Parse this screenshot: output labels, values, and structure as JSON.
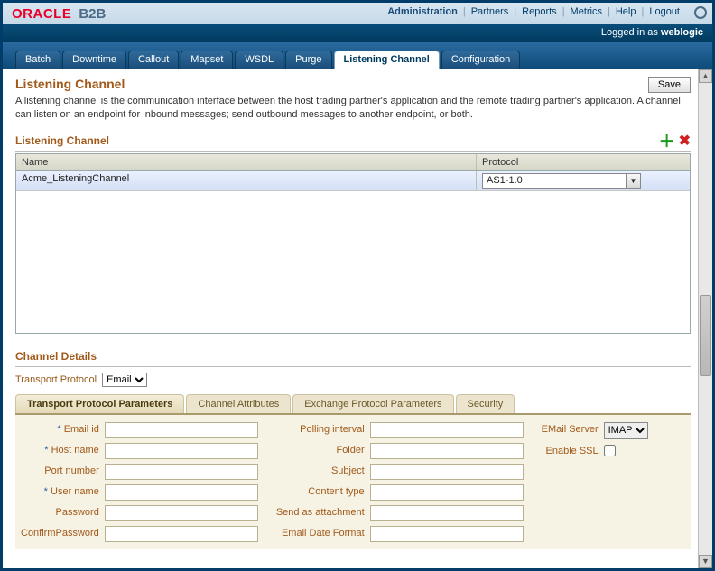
{
  "brand": {
    "oracle": "ORACLE",
    "product": "B2B"
  },
  "header_nav": {
    "administration": "Administration",
    "partners": "Partners",
    "reports": "Reports",
    "metrics": "Metrics",
    "help": "Help",
    "logout": "Logout"
  },
  "login_status": {
    "prefix": "Logged in as ",
    "user": "weblogic"
  },
  "tabs": {
    "batch": "Batch",
    "downtime": "Downtime",
    "callout": "Callout",
    "mapset": "Mapset",
    "wsdl": "WSDL",
    "purge": "Purge",
    "listening_channel": "Listening Channel",
    "configuration": "Configuration"
  },
  "page": {
    "title": "Listening Channel",
    "save": "Save",
    "description": "A listening channel is the communication interface between the host trading partner's application and the remote trading partner's application. A channel can listen on an endpoint for inbound messages; send outbound messages to another endpoint, or both."
  },
  "grid": {
    "title": "Listening Channel",
    "col_name": "Name",
    "col_protocol": "Protocol",
    "rows": [
      {
        "name": "Acme_ListeningChannel",
        "protocol": "AS1-1.0"
      }
    ]
  },
  "details": {
    "title": "Channel Details",
    "transport_protocol_label": "Transport Protocol",
    "transport_protocol_value": "Email"
  },
  "subtabs": {
    "tpp": "Transport Protocol Parameters",
    "channel_attrs": "Channel Attributes",
    "epp": "Exchange Protocol Parameters",
    "security": "Security"
  },
  "form": {
    "email_id": "Email id",
    "host_name": "Host name",
    "port_number": "Port number",
    "user_name": "User name",
    "password": "Password",
    "confirm_password": "ConfirmPassword",
    "polling_interval": "Polling interval",
    "folder": "Folder",
    "subject": "Subject",
    "content_type": "Content type",
    "send_as_attachment": "Send as attachment",
    "email_date_format": "Email Date Format",
    "email_server": "EMail Server",
    "email_server_value": "IMAP",
    "enable_ssl": "Enable SSL",
    "required_mark": "*"
  }
}
